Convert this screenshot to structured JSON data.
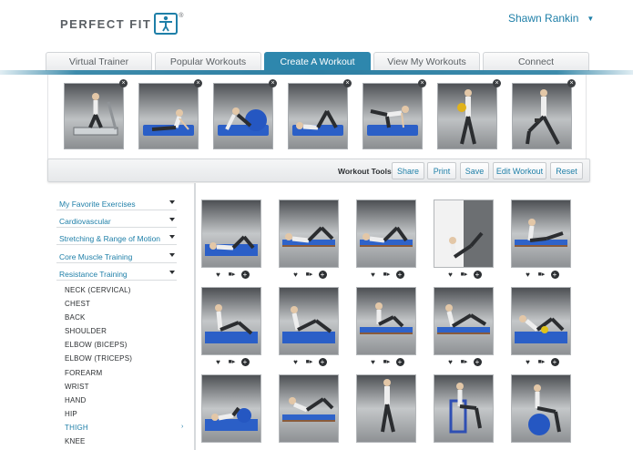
{
  "header": {
    "logo_text": "PERFECT FIT",
    "logo_reg": "®",
    "user_name": "Shawn Rankin",
    "user_caret": "▼"
  },
  "tabs": [
    {
      "label": "Virtual Trainer",
      "active": false
    },
    {
      "label": "Popular Workouts",
      "active": false
    },
    {
      "label": "Create A Workout",
      "active": true
    },
    {
      "label": "View My Workouts",
      "active": false
    },
    {
      "label": "Connect",
      "active": false
    }
  ],
  "workout_strip": {
    "remove_glyph": "×",
    "items": [
      "treadmill",
      "mat-stretch",
      "ball-crunch",
      "mat-leg-raise",
      "bird-dog",
      "medicine-ball",
      "dumbbell-lunge"
    ]
  },
  "tools": {
    "label": "Workout Tools:",
    "share": "Share",
    "print": "Print",
    "save": "Save",
    "edit": "Edit Workout",
    "reset": "Reset"
  },
  "sidebar": {
    "categories": [
      "My Favorite Exercises",
      "Cardiovascular",
      "Stretching & Range of Motion",
      "Core Muscle Training",
      "Resistance Training"
    ],
    "subcategories": [
      "NECK (CERVICAL)",
      "CHEST",
      "BACK",
      "SHOULDER",
      "ELBOW (BICEPS)",
      "ELBOW (TRICEPS)",
      "FOREARM",
      "WRIST",
      "HAND",
      "HIP",
      "THIGH",
      "KNEE"
    ],
    "active_subcategory": "THIGH",
    "active_arrow": "›"
  },
  "exercise_icons": {
    "favorite": "♥",
    "video": "■▸",
    "add": "+"
  },
  "colors": {
    "accent": "#2e87ad",
    "link": "#1e7fa8",
    "mat": "#2b5fc7"
  }
}
